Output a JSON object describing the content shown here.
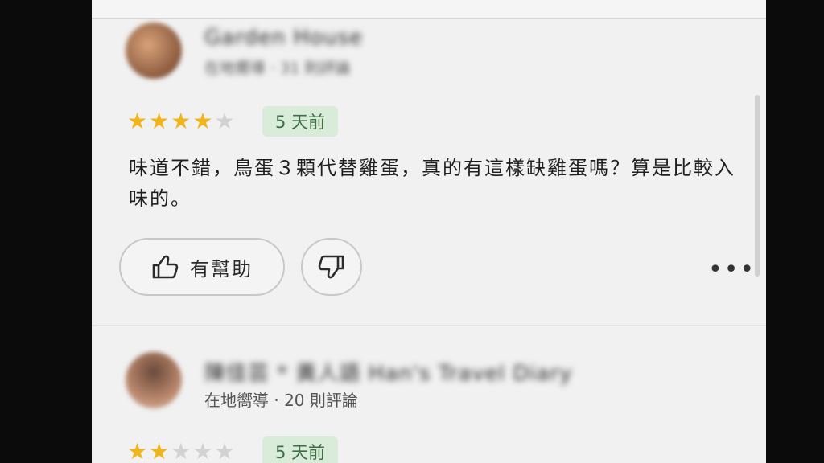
{
  "reviews": [
    {
      "author": "Garden House",
      "author_meta": "在地嚮導 · 31 則評論",
      "rating": 4,
      "stars": "★★★★★",
      "time": "5 天前",
      "text": "味道不錯，鳥蛋３顆代替雞蛋，真的有這樣缺雞蛋嗎？算是比較入味的。",
      "helpful_label": "有幫助",
      "more_label": "•••"
    },
    {
      "author": "陳佳芸 * 黃人語 Han's Travel Diary",
      "author_meta": "在地嚮導 · 20 則評論",
      "rating": 2,
      "stars": "★★★★★",
      "time": "5 天前"
    }
  ],
  "colors": {
    "star_on": "#f0b51d",
    "star_off": "#d2d2d2",
    "badge_bg": "#d9ecd9",
    "badge_text": "#3f6d45"
  },
  "icons": {
    "helpful": "thumbs-up-icon",
    "dislike": "thumbs-down-icon",
    "more": "more-dots-icon"
  }
}
